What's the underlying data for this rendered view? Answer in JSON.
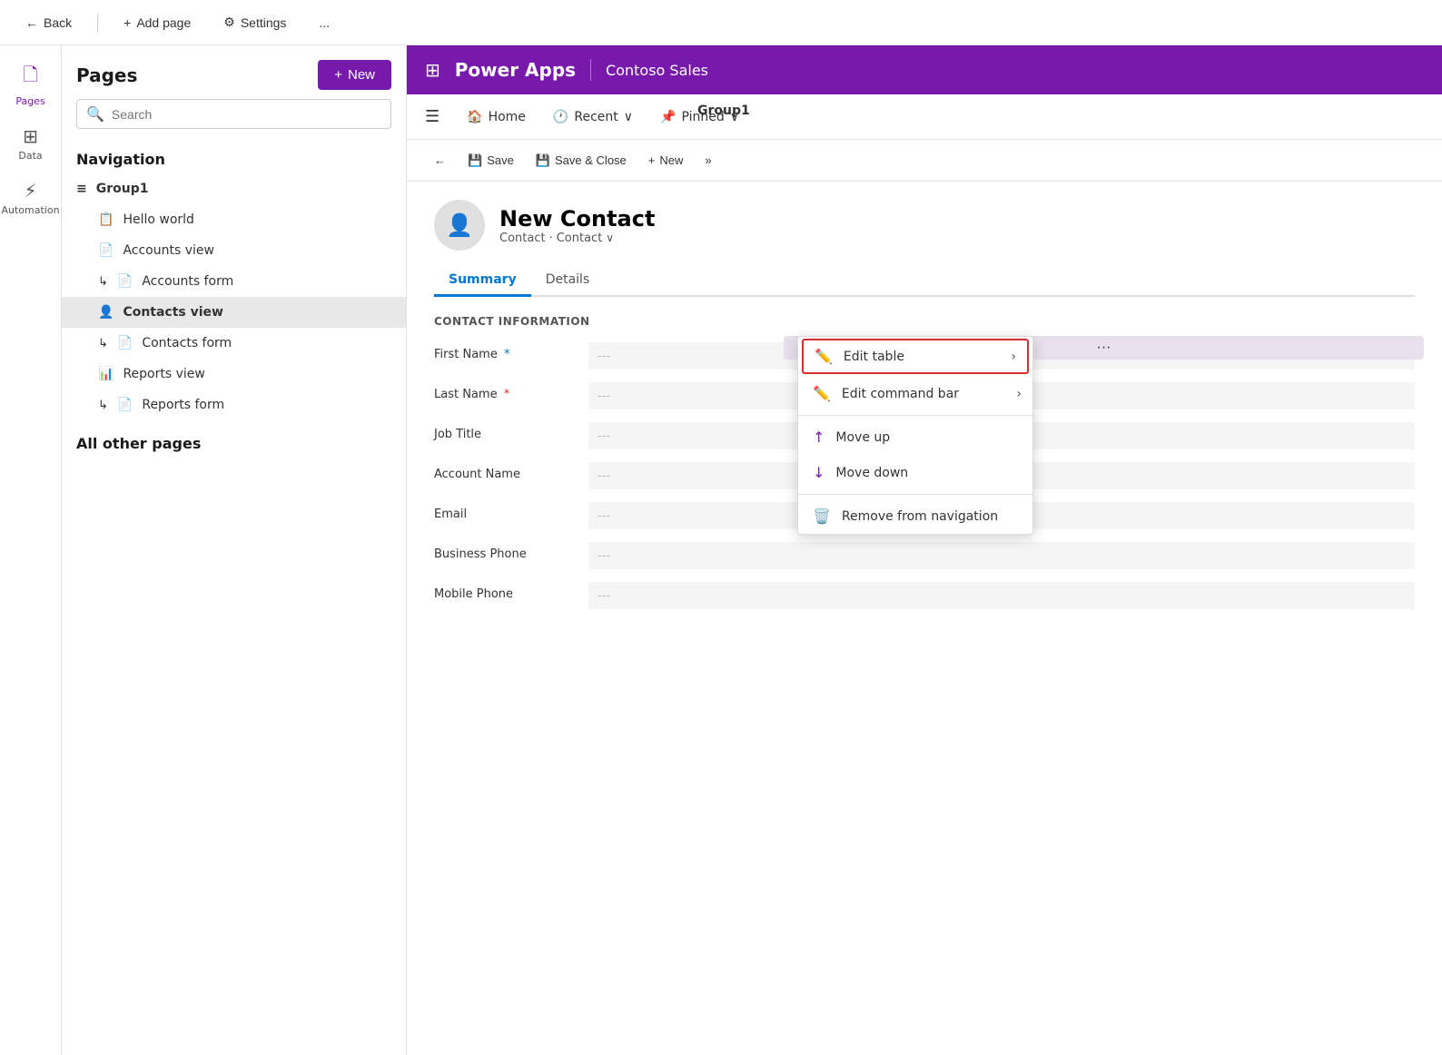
{
  "topbar": {
    "back_label": "Back",
    "add_page_label": "Add page",
    "settings_label": "Settings",
    "more_label": "..."
  },
  "icon_sidebar": {
    "items": [
      {
        "id": "pages",
        "label": "Pages",
        "icon": "🗋",
        "active": true
      },
      {
        "id": "data",
        "label": "Data",
        "icon": "⊞"
      },
      {
        "id": "automation",
        "label": "Automation",
        "icon": "⚡"
      }
    ]
  },
  "pages_panel": {
    "title": "Pages",
    "new_button": "+ New",
    "search_placeholder": "Search",
    "navigation_title": "Navigation",
    "nav_items": [
      {
        "id": "group1",
        "label": "Group1",
        "icon": "≡",
        "type": "group"
      },
      {
        "id": "hello-world",
        "label": "Hello world",
        "icon": "📋",
        "indent": true
      },
      {
        "id": "accounts-view",
        "label": "Accounts view",
        "icon": "📄",
        "indent": true
      },
      {
        "id": "accounts-form",
        "label": "Accounts form",
        "icon": "↳📄",
        "indent": true
      },
      {
        "id": "contacts-view",
        "label": "Contacts view",
        "icon": "👤",
        "indent": true,
        "active": true
      },
      {
        "id": "contacts-form",
        "label": "Contacts form",
        "icon": "↳📄",
        "indent": true
      },
      {
        "id": "reports-view",
        "label": "Reports view",
        "icon": "📊",
        "indent": true
      },
      {
        "id": "reports-form",
        "label": "Reports form",
        "icon": "↳📄",
        "indent": true
      }
    ],
    "all_other_title": "All other pages"
  },
  "app_header": {
    "grid_icon": "⊞",
    "app_name": "Power Apps",
    "app_title": "Contoso Sales"
  },
  "app_nav": {
    "hamburger": "☰",
    "items": [
      {
        "label": "Home",
        "icon": "🏠"
      },
      {
        "label": "Recent",
        "has_chevron": true
      },
      {
        "label": "Pinned",
        "has_chevron": true
      }
    ],
    "group_label": "Group1"
  },
  "toolbar": {
    "back_icon": "←",
    "save_label": "Save",
    "save_close_label": "Save & Close",
    "new_label": "New",
    "forward_icon": "»"
  },
  "form": {
    "avatar_icon": "👤",
    "contact_name": "New Contact",
    "contact_sub1": "Contact",
    "contact_sub2": "Contact",
    "tabs": [
      {
        "label": "Summary",
        "active": true
      },
      {
        "label": "Details",
        "active": false
      }
    ],
    "section_title": "CONTACT INFORMATION",
    "fields": [
      {
        "label": "First Name",
        "required_type": "blue",
        "value": "---"
      },
      {
        "label": "Last Name",
        "required_type": "red",
        "value": "---"
      },
      {
        "label": "Job Title",
        "required_type": "none",
        "value": "---"
      },
      {
        "label": "Account Name",
        "required_type": "none",
        "value": "---"
      },
      {
        "label": "Email",
        "required_type": "none",
        "value": "---"
      },
      {
        "label": "Business Phone",
        "required_type": "none",
        "value": "---"
      },
      {
        "label": "Mobile Phone",
        "required_type": "none",
        "value": "---"
      }
    ]
  },
  "context_menu": {
    "items": [
      {
        "id": "edit-table",
        "label": "Edit table",
        "icon": "✏️",
        "has_chevron": true,
        "highlighted": true
      },
      {
        "id": "edit-command-bar",
        "label": "Edit command bar",
        "icon": "✏️",
        "has_chevron": true
      },
      {
        "id": "move-up",
        "label": "Move up",
        "icon": "↑"
      },
      {
        "id": "move-down",
        "label": "Move down",
        "icon": "↓"
      },
      {
        "id": "remove-nav",
        "label": "Remove from navigation",
        "icon": "🗑️"
      }
    ]
  },
  "colors": {
    "brand_purple": "#7719aa",
    "active_blue": "#0078d4",
    "highlight_red": "#d92c2c"
  }
}
